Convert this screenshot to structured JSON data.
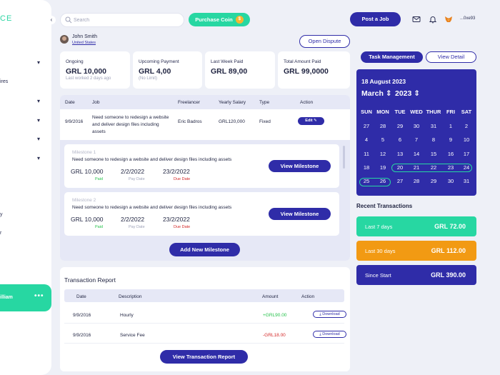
{
  "sidebar": {
    "logo_text": "CE",
    "items": [
      {
        "label": "ires"
      },
      {
        "label": "y"
      },
      {
        "label": "r"
      }
    ],
    "user": {
      "name": "illiam",
      "more": "•••"
    },
    "collapse": "‹"
  },
  "topbar": {
    "search_placeholder": "Search",
    "purchase_label": "Purchase Coin",
    "coin_symbol": "$",
    "post_job_label": "Post a Job",
    "wallet_address": "...0xe93"
  },
  "user": {
    "name": "John Smith",
    "country": "United States"
  },
  "open_dispute_label": "Open Dispute",
  "stats": [
    {
      "label": "Ongoing",
      "value": "GRL 10,000",
      "sub": "Last worked 2 days ago"
    },
    {
      "label": "Upcoming Payment",
      "value": "GRL 4,00",
      "sub": "(No Limit)"
    },
    {
      "label": "Last Week Paid",
      "value": "GRL 89,00",
      "sub": ""
    },
    {
      "label": "Total Amount Paid",
      "value": "GRL 99,0000",
      "sub": ""
    }
  ],
  "jobs_table": {
    "headers": [
      "Date",
      "Job",
      "Freelancer",
      "Yearly Salary",
      "Type",
      "Action"
    ],
    "row": {
      "date": "9/9/2016",
      "job": "Need someone to redesign a website and deliver design files including assets",
      "freelancer": "Eric Badros",
      "salary": "GRL120,000",
      "type": "Fixed",
      "action": "Edit ✎"
    }
  },
  "milestones": [
    {
      "title": "Milestone 1",
      "desc": "Need someone to redesign a website and deliver design files including assets",
      "amount": "GRL 10,000",
      "amount_status": "Paid",
      "pay_date": "2/2/2022",
      "pay_label": "Pay Date",
      "due_date": "23/2/2022",
      "due_label": "Due Date",
      "button": "View Milestone"
    },
    {
      "title": "Milestone 2",
      "desc": "Need someone to redesign a website and deliver design files including assets",
      "amount": "GRL 10,000",
      "amount_status": "Paid",
      "pay_date": "2/2/2022",
      "pay_label": "Pay Date",
      "due_date": "23/2/2022",
      "due_label": "Due Date",
      "button": "View Milestone"
    }
  ],
  "add_milestone_label": "Add New Milestone",
  "transactions": {
    "title": "Transaction Report",
    "headers": [
      "Date",
      "Description",
      "Amount",
      "Action"
    ],
    "rows": [
      {
        "date": "9/9/2016",
        "desc": "Hourly",
        "amount": "+GRL90.00",
        "action": "⤓ Download"
      },
      {
        "date": "9/9/2016",
        "desc": "Service Fee",
        "amount": "-GRL18.00",
        "action": "⤓ Download"
      }
    ],
    "view_label": "View Transaction Report"
  },
  "right": {
    "task_label": "Task Management",
    "view_detail_label": "View Detail",
    "calendar": {
      "date": "18 August 2023",
      "month": "March",
      "year": "2023",
      "days": [
        "SUN",
        "MON",
        "TUE",
        "WED",
        "THUR",
        "FRI",
        "SAT"
      ],
      "weeks": [
        [
          "27",
          "28",
          "29",
          "30",
          "31",
          "1",
          "2"
        ],
        [
          "4",
          "5",
          "6",
          "7",
          "8",
          "9",
          "10"
        ],
        [
          "11",
          "12",
          "13",
          "14",
          "15",
          "16",
          "17"
        ],
        [
          "18",
          "19",
          "20",
          "21",
          "22",
          "23",
          "24"
        ],
        [
          "25",
          "26",
          "27",
          "28",
          "29",
          "30",
          "31"
        ]
      ]
    },
    "recent_title": "Recent Transactions",
    "recent": [
      {
        "label": "Last 7 days",
        "value": "GRL 72.00",
        "color": "#27d7a2"
      },
      {
        "label": "Last 30 days",
        "value": "GRL 112.00",
        "color": "#f29a13"
      },
      {
        "label": "Since Start",
        "value": "GRL 390.00",
        "color": "#2f2ca8"
      }
    ]
  },
  "colors": {
    "primary": "#2f2ca8",
    "accent": "#27d7a2",
    "orange": "#f29a13",
    "paid": "#27c24c",
    "due": "#d42a2a"
  }
}
